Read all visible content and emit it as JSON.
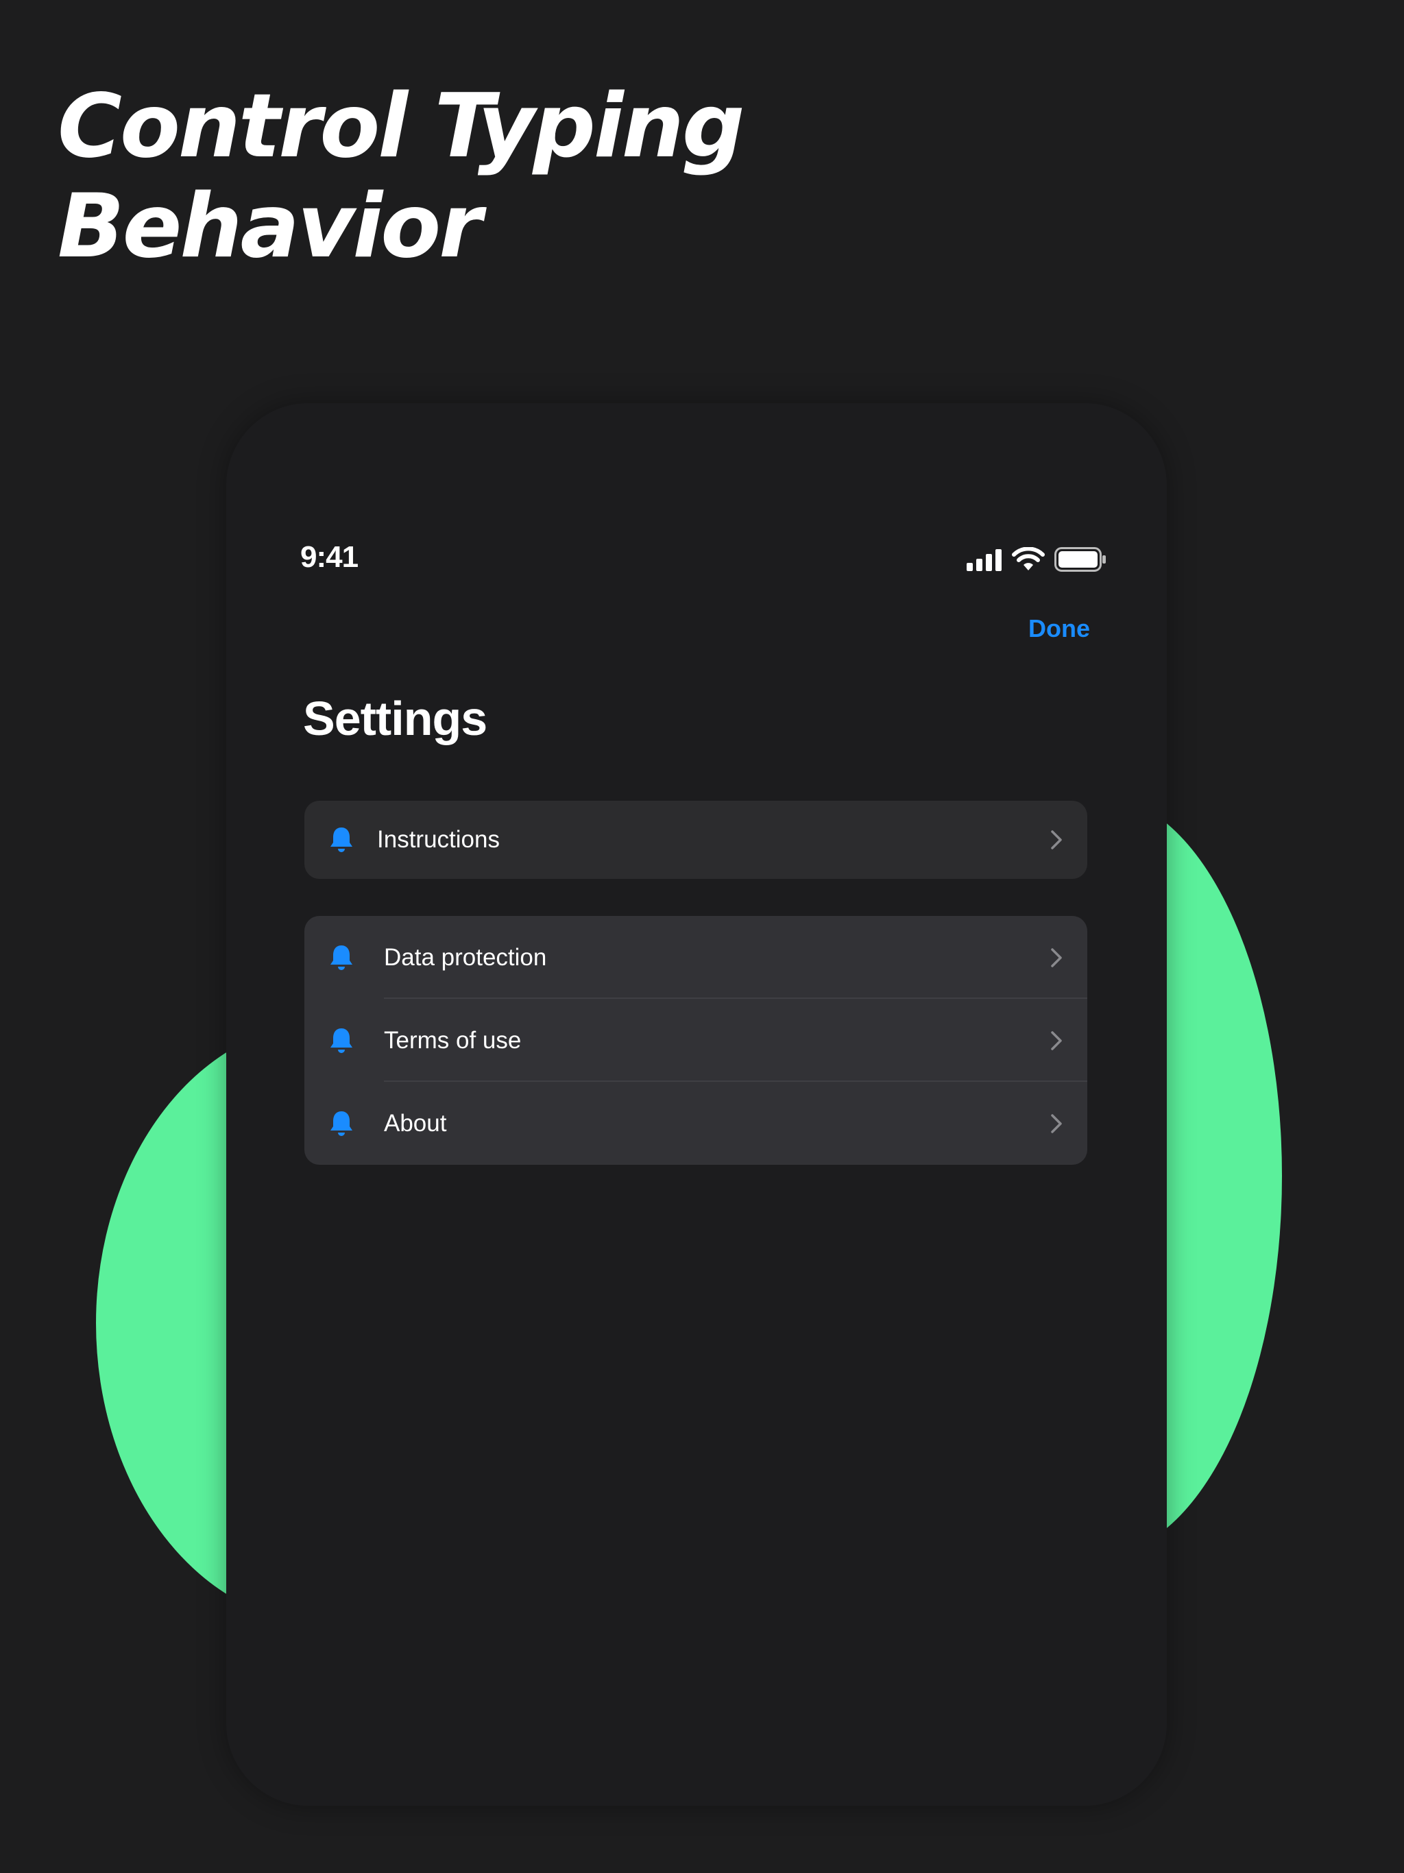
{
  "headline": {
    "line1": "Control Typing",
    "line2": "Behavior"
  },
  "status_bar": {
    "time": "9:41",
    "icons": [
      "cellular-signal-icon",
      "wifi-icon",
      "battery-icon"
    ]
  },
  "nav": {
    "done_label": "Done"
  },
  "page": {
    "title": "Settings"
  },
  "groups": [
    {
      "items": [
        {
          "label": "Instructions",
          "icon": "bell-icon"
        }
      ]
    },
    {
      "items": [
        {
          "label": "Data protection",
          "icon": "bell-icon"
        },
        {
          "label": "Terms of use",
          "icon": "bell-icon"
        },
        {
          "label": "About",
          "icon": "bell-icon"
        }
      ]
    }
  ],
  "colors": {
    "background": "#1d1d1e",
    "accent": "#1a8cff",
    "blob": "#5bf09b",
    "cell": "#2c2c2e"
  }
}
